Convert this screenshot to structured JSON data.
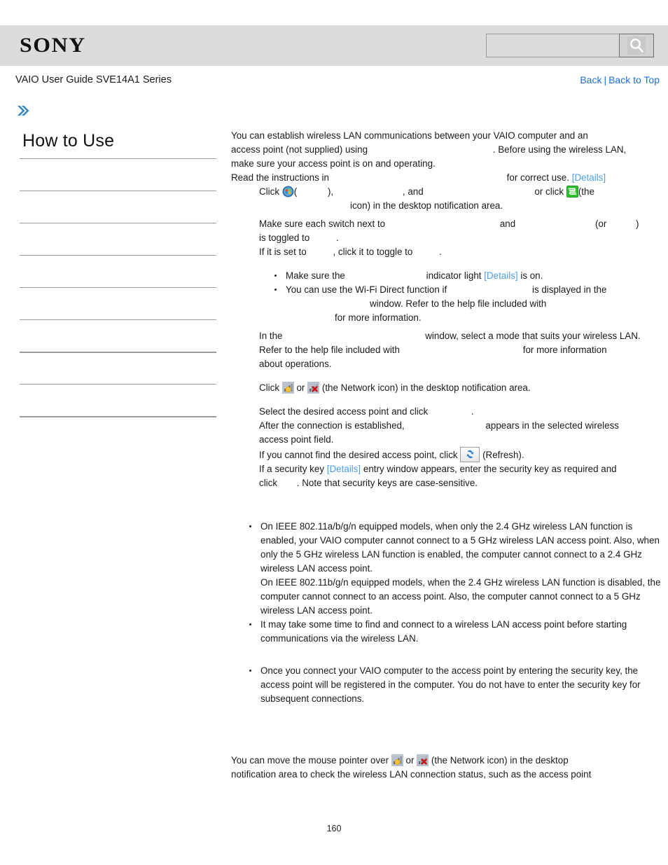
{
  "header": {
    "logo_text": "SONY",
    "search": {
      "value": "",
      "placeholder": "",
      "icon": "search-icon"
    }
  },
  "title_row": {
    "guide_title": "VAIO User Guide SVE14A1 Series",
    "links": {
      "back": "Back",
      "separator": "|",
      "back_to_top": "Back to Top"
    }
  },
  "breadcrumb": {
    "icon": "double-chevron-right-icon",
    "text": ""
  },
  "sidebar": {
    "heading": "How to Use",
    "items": [
      {
        "label": ""
      },
      {
        "label": ""
      },
      {
        "label": ""
      },
      {
        "label": ""
      },
      {
        "label": ""
      },
      {
        "label": ""
      },
      {
        "label": ""
      },
      {
        "label": ""
      },
      {
        "label": ""
      }
    ]
  },
  "article": {
    "intro": {
      "line1": "You can establish wireless LAN communications between your VAIO computer and an",
      "line2_a": "access point (not supplied) using",
      "line2_b": ". Before using the wireless LAN,",
      "line3": "make sure your access point is on and operating.",
      "line4_a": "Read the instructions in",
      "line4_b": "for correct use.",
      "line4_details": "[Details]"
    },
    "step1": {
      "click": "Click",
      "start_icon": "windows-start-icon",
      "paren_open": "(",
      "paren_close": "),",
      "comma_and": ", and",
      "or_click": "or click",
      "vaio_icon": "vaio-smart-network-icon",
      "the_open": "(the",
      "line2": "icon) in the desktop notification area."
    },
    "step2": {
      "line1_a": "Make sure each switch next to",
      "line1_and": "and",
      "line1_or_open": "(or",
      "line1_or_close": ")",
      "line2": "is toggled to",
      "line2_end": ".",
      "line3_a": "If it is set to",
      "line3_b": ", click it to toggle to",
      "line3_end": "."
    },
    "notes1": [
      {
        "a": "Make sure the",
        "b": "indicator light",
        "details": "[Details]",
        "c": "is on."
      },
      {
        "a": "You can use the Wi-Fi Direct function if",
        "b": "is displayed in the",
        "c": "window. Refer to the help file included with",
        "d": "for more information."
      }
    ],
    "step3": {
      "line1_a": "In the",
      "line1_b": "window, select a mode that suits your wireless LAN.",
      "line2_a": "Refer to the help file included with",
      "line2_b": "for more information",
      "line3": "about operations."
    },
    "step4": {
      "click": "Click",
      "network_icon_ok": "network-signal-icon",
      "or": "or",
      "network_icon_x": "network-disconnected-icon",
      "rest": "(the Network icon) in the desktop notification area."
    },
    "step5": {
      "line1_a": "Select the desired access point and click",
      "line1_end": ".",
      "line2_a": "After the connection is established,",
      "line2_b": "appears in the selected wireless",
      "line3": "access point field.",
      "line4_a": "If you cannot find the desired access point, click",
      "refresh_icon": "refresh-icon",
      "line4_b": "(Refresh).",
      "line5_a": "If a security key",
      "line5_details": "[Details]",
      "line5_b": "entry window appears, enter the security key as required and",
      "line6_a": "click",
      "line6_b": ". Note that security keys are case-sensitive."
    },
    "notes2": [
      "On IEEE 802.11a/b/g/n equipped models, when only the 2.4 GHz wireless LAN function is enabled, your VAIO computer cannot connect to a 5 GHz wireless LAN access point. Also, when only the 5 GHz wireless LAN function is enabled, the computer cannot connect to a 2.4 GHz wireless LAN access point.",
      "On IEEE 802.11b/g/n equipped models, when the 2.4 GHz wireless LAN function is disabled, the computer cannot connect to an access point. Also, the computer cannot connect to a 5 GHz wireless LAN access point.",
      "It may take some time to find and connect to a wireless LAN access point before starting communications via the wireless LAN."
    ],
    "notes3": [
      "Once you connect your VAIO computer to the access point by entering the security key, the access point will be registered in the computer. You do not have to enter the security key for subsequent connections."
    ],
    "tail": {
      "line1_a": "You can move the mouse pointer over",
      "or": "or",
      "line1_b": "(the Network icon) in the desktop",
      "line2": "notification area to check the wireless LAN connection status, such as the access point"
    }
  },
  "footer": {
    "page_number": "160"
  },
  "colors": {
    "header_bg": "#dcdcdc",
    "link": "#1a6fd4",
    "details_link": "#4a9fe8",
    "rule": "#9b9b9b",
    "chevron": "#2f85c6"
  }
}
